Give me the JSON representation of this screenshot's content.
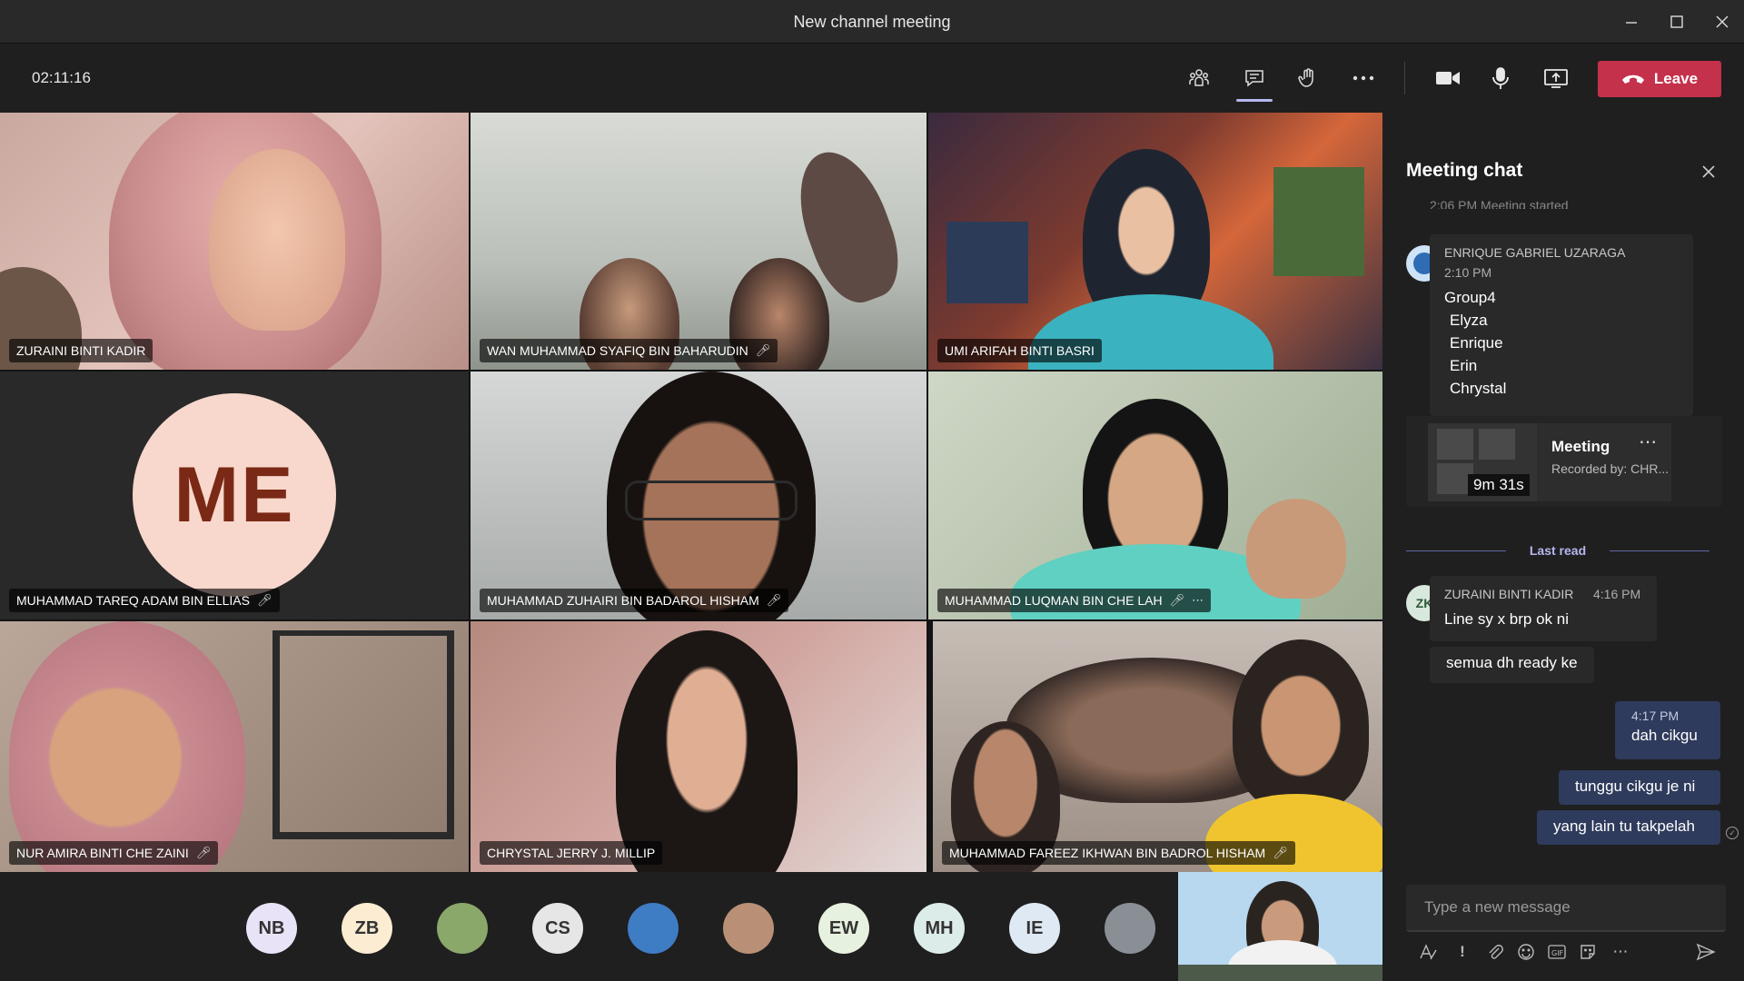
{
  "window": {
    "title": "New channel meeting"
  },
  "toolbar": {
    "timer": "02:11:16",
    "leave_label": "Leave"
  },
  "participants": [
    {
      "name": "ZURAINI BINTI KADIR"
    },
    {
      "name": "WAN MUHAMMAD SYAFIQ BIN BAHARUDIN"
    },
    {
      "name": "UMI ARIFAH BINTI BASRI"
    },
    {
      "name": "MUHAMMAD TAREQ ADAM BIN ELLIAS",
      "initials": "ME"
    },
    {
      "name": "MUHAMMAD ZUHAIRI BIN BADAROL HISHAM"
    },
    {
      "name": "MUHAMMAD LUQMAN BIN CHE LAH"
    },
    {
      "name": "NUR AMIRA BINTI CHE ZAINI"
    },
    {
      "name": "CHRYSTAL JERRY J. MILLIP"
    },
    {
      "name": "MUHAMMAD FAREEZ IKHWAN BIN BADROL HISHAM"
    }
  ],
  "roster": [
    {
      "initials": "NB",
      "color": "#e8e3f6"
    },
    {
      "initials": "ZB",
      "color": "#fbecd2"
    },
    {
      "initials": "",
      "color": "#8aa86a"
    },
    {
      "initials": "CS",
      "color": "#e6e6e6"
    },
    {
      "initials": "",
      "color": "#3e7cc4"
    },
    {
      "initials": "",
      "color": "#b98f76"
    },
    {
      "initials": "EW",
      "color": "#e7f1df"
    },
    {
      "initials": "MH",
      "color": "#dcece9"
    },
    {
      "initials": "IE",
      "color": "#dfe9f3"
    },
    {
      "initials": "",
      "color": "#8a8f96"
    }
  ],
  "chat": {
    "title": "Meeting chat",
    "system_message": "2:06 PM   Meeting started",
    "msg1": {
      "sender": "ENRIQUE GABRIEL UZARAGA",
      "time": "2:10 PM",
      "lines": [
        "Group4",
        "Elyza",
        "Enrique",
        "Erin",
        "Chrystal"
      ]
    },
    "recording": {
      "title": "Meeting",
      "subtitle": "Recorded by: CHR...",
      "duration": "9m 31s"
    },
    "last_read": "Last read",
    "msg2": {
      "initials": "ZK",
      "sender": "ZURAINI BINTI KADIR",
      "time": "4:16 PM",
      "text1": "Line sy x brp ok ni",
      "text2": "semua dh ready ke"
    },
    "mine": {
      "time": "4:17 PM",
      "text1": "dah cikgu",
      "text2": "tunggu cikgu je ni",
      "text3": "yang lain tu takpelah"
    },
    "compose_placeholder": "Type a new message"
  }
}
